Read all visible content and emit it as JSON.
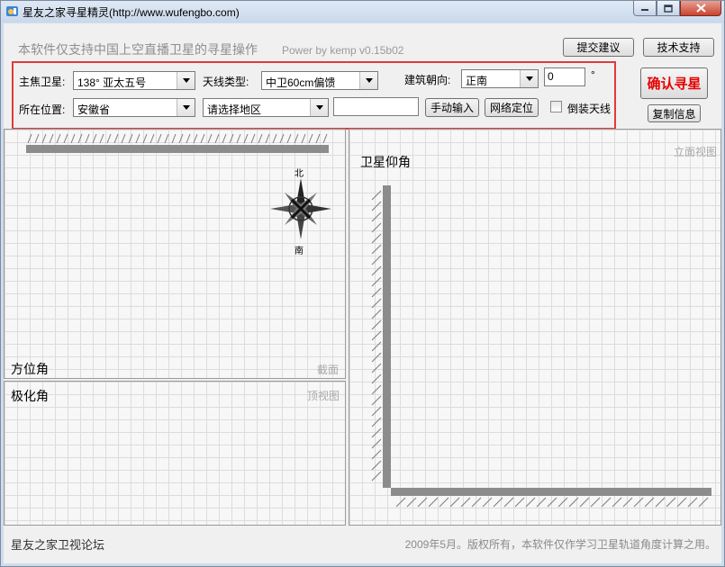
{
  "window": {
    "title": "星友之家寻星精灵(http://www.wufengbo.com)"
  },
  "header": {
    "notice": "本软件仅支持中国上空直播卫星的寻星操作",
    "power": "Power by kemp  v0.15b02"
  },
  "buttons": {
    "suggest": "提交建议",
    "support": "技术支持",
    "confirm": "确认寻星",
    "copy": "复制信息",
    "manual": "手动输入",
    "network": "网络定位"
  },
  "form": {
    "satellite_label": "主焦卫星:",
    "satellite_value": "138°   亚太五号",
    "antenna_label": "天线类型:",
    "antenna_value": "中卫60cm偏馈",
    "orientation_label": "建筑朝向:",
    "orientation_value": "正南",
    "orientation_degree": "0",
    "degree_symbol": "°",
    "location_label": "所在位置:",
    "province_value": "安徽省",
    "region_value": "请选择地区",
    "city_input": "",
    "invert_label": "倒装天线"
  },
  "panels": {
    "azimuth": {
      "title": "方位角",
      "tag": "截面"
    },
    "polar": {
      "title": "极化角",
      "tag": "顶视图"
    },
    "elevation": {
      "title": "卫星仰角",
      "tag": "立面视图"
    }
  },
  "compass": {
    "north": "北",
    "south": "南"
  },
  "status": {
    "left": "星友之家卫视论坛",
    "right": "2009年5月。版权所有，本软件仅作学习卫星轨道角度计算之用。"
  }
}
